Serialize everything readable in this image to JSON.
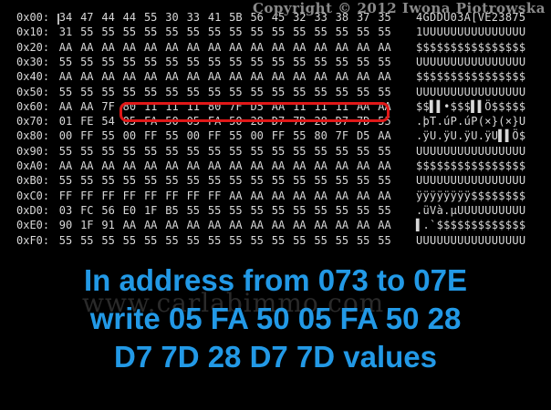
{
  "copyright": "Copyright © 2012 Iwona Piotrowska",
  "watermark": "www.carlabimmo.com",
  "instruction": [
    "In address from 073 to 07E",
    "write 05 FA 50 05 FA 50 28",
    "D7 7D 28 D7 7D values"
  ],
  "colors": {
    "background": "#000000",
    "hex_text": "#d8d8d8",
    "highlight": "#e01818",
    "instruction": "#2299e6"
  },
  "highlighted_range": {
    "start": "073",
    "end": "07E"
  },
  "rows": [
    {
      "addr": "0x00:",
      "bytes": [
        "34",
        "47",
        "44",
        "44",
        "55",
        "30",
        "33",
        "41",
        "5B",
        "56",
        "45",
        "32",
        "33",
        "38",
        "37",
        "35"
      ],
      "ascii": "4GDDU03A[VE23875"
    },
    {
      "addr": "0x10:",
      "bytes": [
        "31",
        "55",
        "55",
        "55",
        "55",
        "55",
        "55",
        "55",
        "55",
        "55",
        "55",
        "55",
        "55",
        "55",
        "55",
        "55"
      ],
      "ascii": "1UUUUUUUUUUUUUUU"
    },
    {
      "addr": "0x20:",
      "bytes": [
        "AA",
        "AA",
        "AA",
        "AA",
        "AA",
        "AA",
        "AA",
        "AA",
        "AA",
        "AA",
        "AA",
        "AA",
        "AA",
        "AA",
        "AA",
        "AA"
      ],
      "ascii": "$$$$$$$$$$$$$$$$"
    },
    {
      "addr": "0x30:",
      "bytes": [
        "55",
        "55",
        "55",
        "55",
        "55",
        "55",
        "55",
        "55",
        "55",
        "55",
        "55",
        "55",
        "55",
        "55",
        "55",
        "55"
      ],
      "ascii": "UUUUUUUUUUUUUUUU"
    },
    {
      "addr": "0x40:",
      "bytes": [
        "AA",
        "AA",
        "AA",
        "AA",
        "AA",
        "AA",
        "AA",
        "AA",
        "AA",
        "AA",
        "AA",
        "AA",
        "AA",
        "AA",
        "AA",
        "AA"
      ],
      "ascii": "$$$$$$$$$$$$$$$$"
    },
    {
      "addr": "0x50:",
      "bytes": [
        "55",
        "55",
        "55",
        "55",
        "55",
        "55",
        "55",
        "55",
        "55",
        "55",
        "55",
        "55",
        "55",
        "55",
        "55",
        "55"
      ],
      "ascii": "UUUUUUUUUUUUUUUU"
    },
    {
      "addr": "0x60:",
      "bytes": [
        "AA",
        "AA",
        "7F",
        "80",
        "11",
        "11",
        "11",
        "80",
        "7F",
        "D5",
        "AA",
        "11",
        "11",
        "11",
        "AA",
        "AA"
      ],
      "ascii": "$$▌▌•$$$▌▌Ö$$$$$"
    },
    {
      "addr": "0x70:",
      "bytes": [
        "01",
        "FE",
        "54",
        "05",
        "FA",
        "50",
        "05",
        "FA",
        "50",
        "28",
        "D7",
        "7D",
        "28",
        "D7",
        "7D",
        "55"
      ],
      "ascii": ".þT.úP.úP(×}(×}U"
    },
    {
      "addr": "0x80:",
      "bytes": [
        "00",
        "FF",
        "55",
        "00",
        "FF",
        "55",
        "00",
        "FF",
        "55",
        "00",
        "FF",
        "55",
        "80",
        "7F",
        "D5",
        "AA"
      ],
      "ascii": ".ÿU.ÿU.ÿU.ÿU▌▌Ö$"
    },
    {
      "addr": "0x90:",
      "bytes": [
        "55",
        "55",
        "55",
        "55",
        "55",
        "55",
        "55",
        "55",
        "55",
        "55",
        "55",
        "55",
        "55",
        "55",
        "55",
        "55"
      ],
      "ascii": "UUUUUUUUUUUUUUUU"
    },
    {
      "addr": "0xA0:",
      "bytes": [
        "AA",
        "AA",
        "AA",
        "AA",
        "AA",
        "AA",
        "AA",
        "AA",
        "AA",
        "AA",
        "AA",
        "AA",
        "AA",
        "AA",
        "AA",
        "AA"
      ],
      "ascii": "$$$$$$$$$$$$$$$$"
    },
    {
      "addr": "0xB0:",
      "bytes": [
        "55",
        "55",
        "55",
        "55",
        "55",
        "55",
        "55",
        "55",
        "55",
        "55",
        "55",
        "55",
        "55",
        "55",
        "55",
        "55"
      ],
      "ascii": "UUUUUUUUUUUUUUUU"
    },
    {
      "addr": "0xC0:",
      "bytes": [
        "FF",
        "FF",
        "FF",
        "FF",
        "FF",
        "FF",
        "FF",
        "FF",
        "AA",
        "AA",
        "AA",
        "AA",
        "AA",
        "AA",
        "AA",
        "AA"
      ],
      "ascii": "ÿÿÿÿÿÿÿÿ$$$$$$$$"
    },
    {
      "addr": "0xD0:",
      "bytes": [
        "03",
        "FC",
        "56",
        "E0",
        "1F",
        "B5",
        "55",
        "55",
        "55",
        "55",
        "55",
        "55",
        "55",
        "55",
        "55",
        "55"
      ],
      "ascii": ".üVà.µUUUUUUUUUU"
    },
    {
      "addr": "0xE0:",
      "bytes": [
        "90",
        "1F",
        "91",
        "AA",
        "AA",
        "AA",
        "AA",
        "AA",
        "AA",
        "AA",
        "AA",
        "AA",
        "AA",
        "AA",
        "AA",
        "AA"
      ],
      "ascii": "▌.`$$$$$$$$$$$$$"
    },
    {
      "addr": "0xF0:",
      "bytes": [
        "55",
        "55",
        "55",
        "55",
        "55",
        "55",
        "55",
        "55",
        "55",
        "55",
        "55",
        "55",
        "55",
        "55",
        "55",
        "55"
      ],
      "ascii": "UUUUUUUUUUUUUUUU"
    }
  ]
}
